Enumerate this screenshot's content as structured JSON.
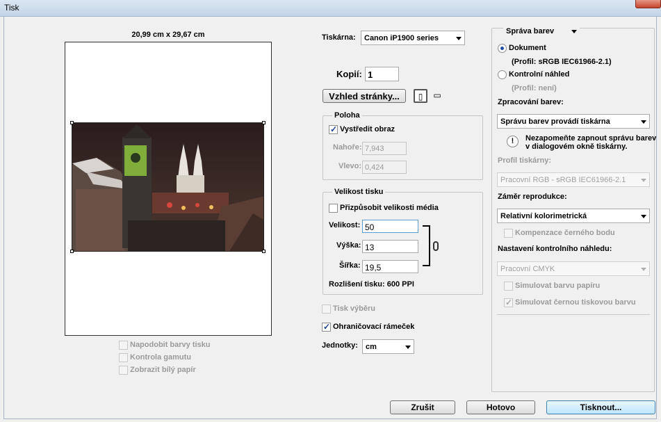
{
  "window": {
    "title": "Tisk"
  },
  "preview": {
    "paper_size": "20,99 cm x 29,67 cm",
    "options": [
      {
        "label": "Napodobit barvy tisku",
        "checked": false
      },
      {
        "label": "Kontrola gamutu",
        "checked": false
      },
      {
        "label": "Zobrazit bílý papír",
        "checked": false
      }
    ]
  },
  "printer": {
    "label": "Tiskárna:",
    "value": "Canon iP1900 series",
    "copies_label": "Kopií:",
    "copies_value": "1",
    "page_setup_label": "Vzhled stránky..."
  },
  "position": {
    "title": "Poloha",
    "center_label": "Vystředit obraz",
    "center_checked": true,
    "top_label": "Nahoře:",
    "top_value": "7,943",
    "left_label": "Vlevo:",
    "left_value": "0,424"
  },
  "print_size": {
    "title": "Velikost tisku",
    "fit_label": "Přizpůsobit velikosti média",
    "fit_checked": false,
    "scale_label": "Velikost:",
    "scale_value": "50",
    "height_label": "Výška:",
    "height_value": "13",
    "width_label": "Šířka:",
    "width_value": "19,5",
    "resolution_text": "Rozlišení tisku: 600 PPI"
  },
  "misc": {
    "selection_label": "Tisk výběru",
    "selection_checked": false,
    "bbox_label": "Ohraničovací rámeček",
    "bbox_checked": true,
    "units_label": "Jednotky:",
    "units_value": "cm"
  },
  "color": {
    "section_dropdown": "Správa barev",
    "document_label": "Dokument",
    "document_profile": "(Profil: sRGB IEC61966-2.1)",
    "document_selected": true,
    "proof_label": "Kontrolní náhled",
    "proof_profile": "(Profil: není)",
    "handling_label": "Zpracování barev:",
    "handling_value": "Správu barev provádí tiskárna",
    "warning_text_1": "Nezapomeňte zapnout správu barev",
    "warning_text_2": "v dialogovém okně tiskárny.",
    "printer_profile_label": "Profil tiskárny:",
    "printer_profile_value": "Pracovní RGB - sRGB IEC61966-2.1",
    "intent_label": "Záměr reprodukce:",
    "intent_value": "Relativní kolorimetrická",
    "bpc_label": "Kompenzace černého bodu",
    "proof_setup_label": "Nastavení kontrolního náhledu:",
    "proof_setup_value": "Pracovní CMYK",
    "sim_paper_label": "Simulovat barvu papíru",
    "sim_ink_label": "Simulovat černou tiskovou barvu",
    "sim_ink_checked": true
  },
  "buttons": {
    "cancel": "Zrušit",
    "done": "Hotovo",
    "print": "Tisknout..."
  }
}
